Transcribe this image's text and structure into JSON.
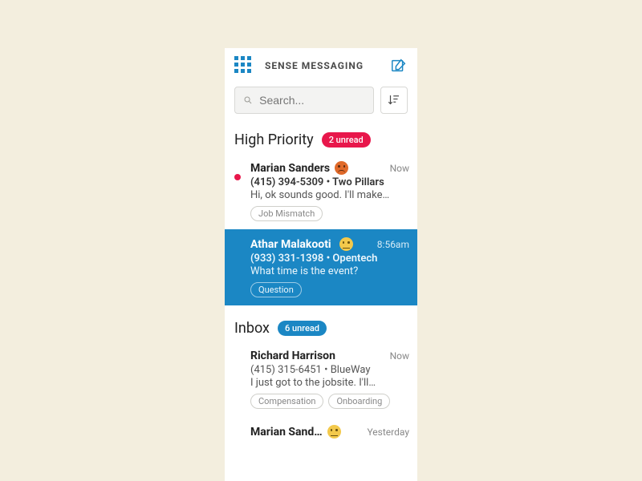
{
  "header": {
    "title": "SENSE MESSAGING"
  },
  "search": {
    "placeholder": "Search..."
  },
  "sections": [
    {
      "title": "High Priority",
      "badge": "2 unread",
      "badgeColor": "red",
      "threads": [
        {
          "unread": true,
          "selected": false,
          "name": "Marian Sanders",
          "emoji": "angry",
          "timestamp": "Now",
          "phone": "(415) 394-5309",
          "org": "Two Pillars",
          "preview": "Hi, ok sounds good. I'll make…",
          "tags": [
            "Job Mismatch"
          ]
        },
        {
          "unread": false,
          "selected": true,
          "name": "Athar Malakooti",
          "emoji": "neutral",
          "timestamp": "8:56am",
          "phone": "(933) 331-1398",
          "org": "Opentech",
          "preview": "What time is the event?",
          "tags": [
            "Question"
          ]
        }
      ]
    },
    {
      "title": "Inbox",
      "badge": "6 unread",
      "badgeColor": "blue",
      "threads": [
        {
          "unread": false,
          "selected": false,
          "name": "Richard Harrison",
          "emoji": "",
          "timestamp": "Now",
          "phone": "(415) 315-6451",
          "org": "BlueWay",
          "preview": "I just got to the jobsite. I'll…",
          "tags": [
            "Compensation",
            "Onboarding"
          ]
        },
        {
          "unread": true,
          "selected": false,
          "name": "Marian Sand…",
          "emoji": "neutral",
          "timestamp": "Yesterday",
          "phone": "",
          "org": "",
          "preview": "",
          "tags": []
        }
      ]
    }
  ]
}
